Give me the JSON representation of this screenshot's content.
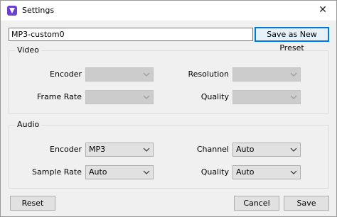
{
  "window": {
    "title": "Settings",
    "close_glyph": "✕"
  },
  "preset": {
    "name": "MP3-custom0",
    "save_label": "Save as New Preset"
  },
  "video": {
    "title": "Video",
    "encoder_label": "Encoder",
    "framerate_label": "Frame Rate",
    "resolution_label": "Resolution",
    "quality_label": "Quality",
    "encoder_value": "",
    "framerate_value": "",
    "resolution_value": "",
    "quality_value": ""
  },
  "audio": {
    "title": "Audio",
    "encoder_label": "Encoder",
    "samplerate_label": "Sample Rate",
    "channel_label": "Channel",
    "quality_label": "Quality",
    "encoder_value": "MP3",
    "samplerate_value": "Auto",
    "channel_value": "Auto",
    "quality_value": "Auto"
  },
  "footer": {
    "reset_label": "Reset",
    "cancel_label": "Cancel",
    "save_label": "Save"
  },
  "colors": {
    "accent": "#0078d7",
    "app_icon": "#6a3fd1"
  }
}
